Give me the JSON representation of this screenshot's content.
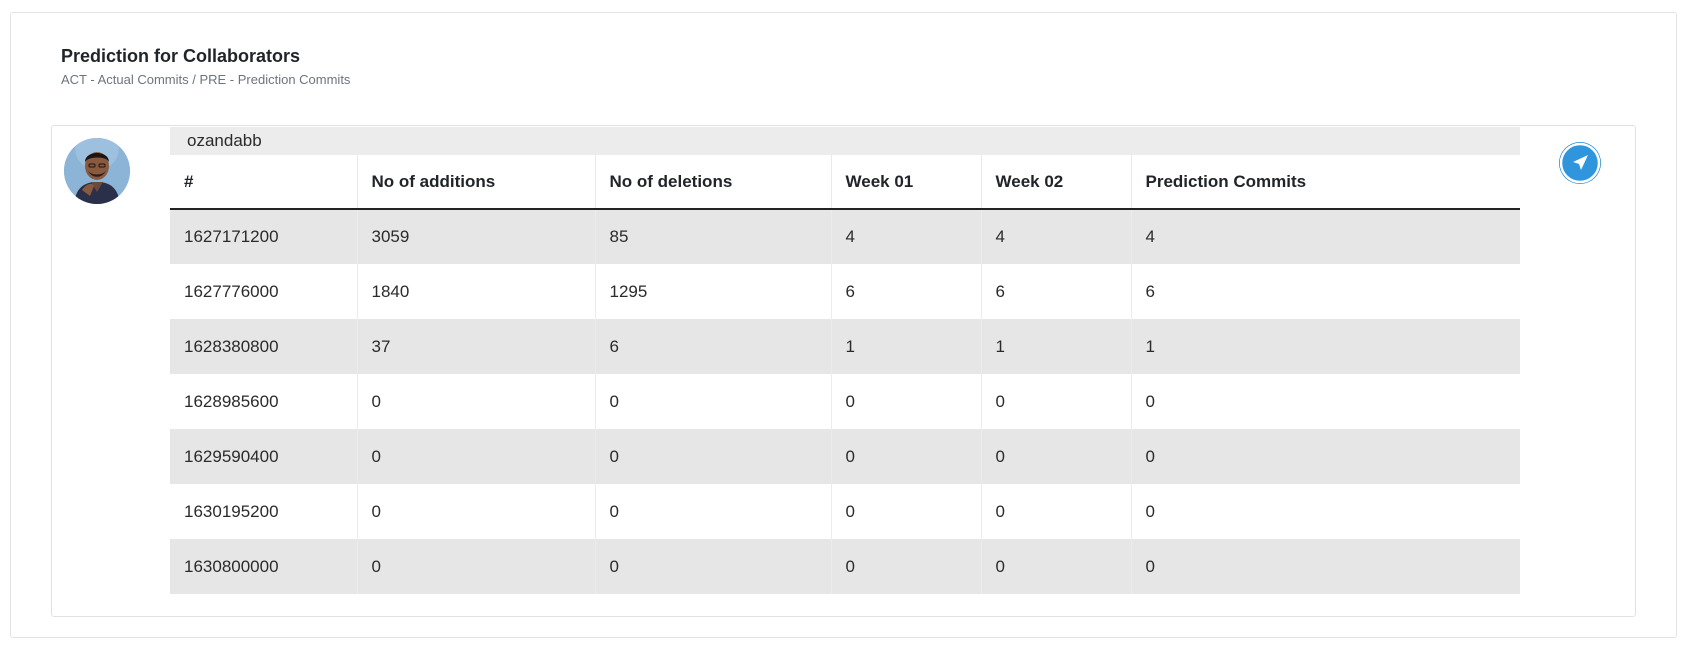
{
  "header": {
    "title": "Prediction for Collaborators",
    "subtitle": "ACT - Actual Commits / PRE - Prediction Commits"
  },
  "collaborator": {
    "username": "ozandabb",
    "avatar_icon": "user-avatar-photo",
    "action_icon": "navigation-arrow-icon",
    "action_color": "#1e88d6"
  },
  "table": {
    "columns": [
      "#",
      "No of additions",
      "No of deletions",
      "Week 01",
      "Week 02",
      "Prediction Commits"
    ],
    "rows": [
      [
        "1627171200",
        "3059",
        "85",
        "4",
        "4",
        "4"
      ],
      [
        "1627776000",
        "1840",
        "1295",
        "6",
        "6",
        "6"
      ],
      [
        "1628380800",
        "37",
        "6",
        "1",
        "1",
        "1"
      ],
      [
        "1628985600",
        "0",
        "0",
        "0",
        "0",
        "0"
      ],
      [
        "1629590400",
        "0",
        "0",
        "0",
        "0",
        "0"
      ],
      [
        "1630195200",
        "0",
        "0",
        "0",
        "0",
        "0"
      ],
      [
        "1630800000",
        "0",
        "0",
        "0",
        "0",
        "0"
      ]
    ]
  }
}
